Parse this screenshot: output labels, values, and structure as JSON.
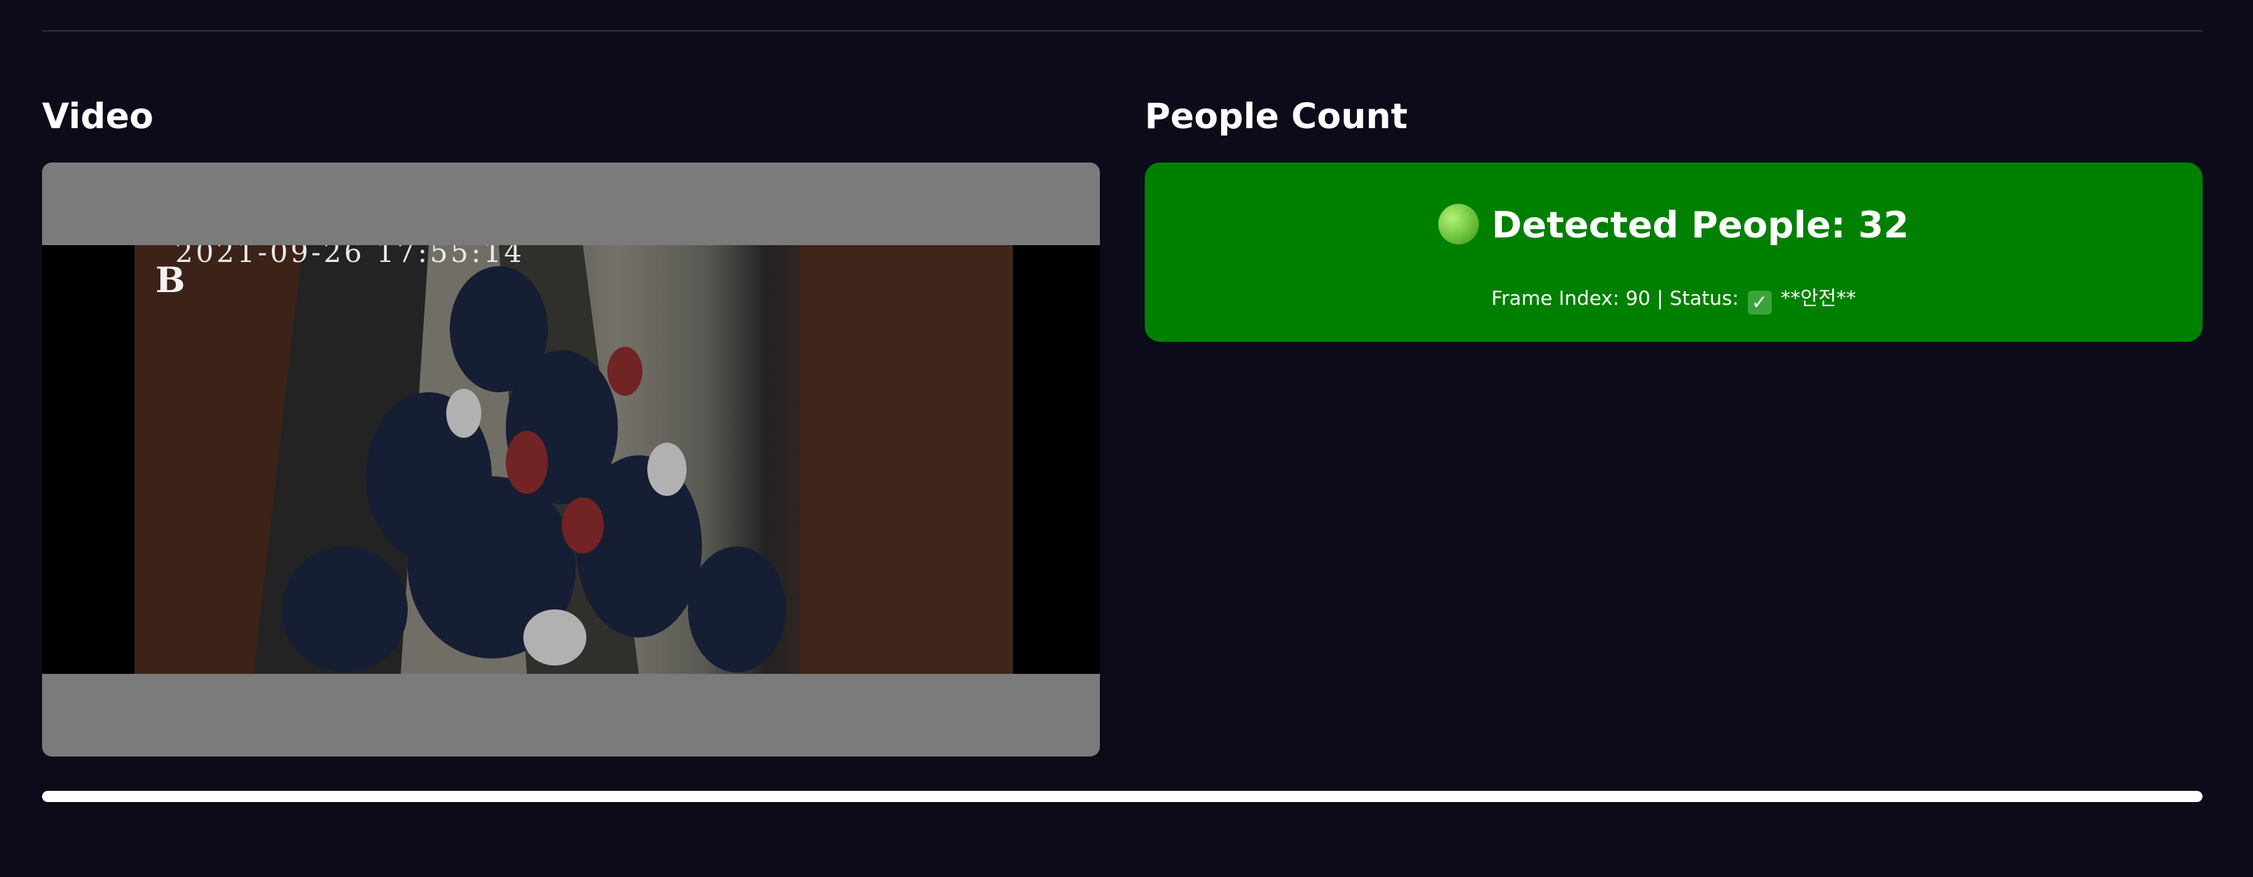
{
  "sections": {
    "video_title": "Video",
    "count_title": "People Count"
  },
  "video": {
    "timestamp": "2021-09-26 17:55:14",
    "logo": "B"
  },
  "people_count": {
    "icon": "green-circle-icon",
    "label": "Detected People:",
    "count": "32",
    "frame_label": "Frame Index:",
    "frame_index": "90",
    "separator": "|",
    "status_label": "Status:",
    "status_icon": "check-mark-icon",
    "status_value": "**안전**",
    "card_color": "#008000"
  },
  "progress": {
    "fraction": 1.0
  }
}
